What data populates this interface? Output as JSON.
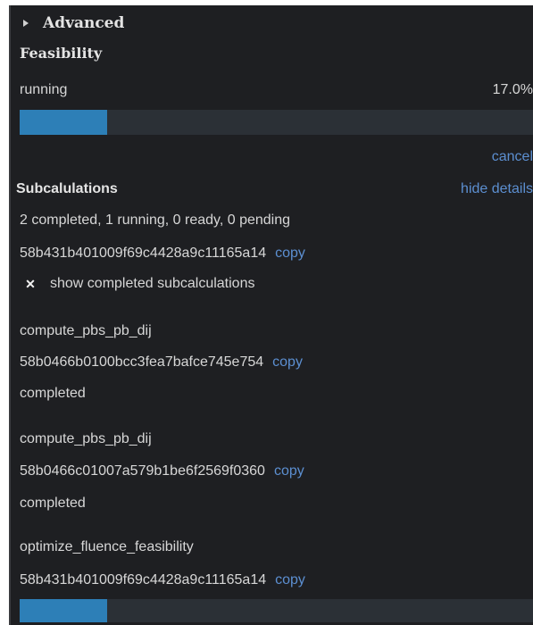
{
  "advanced": {
    "label": "Advanced"
  },
  "feasibility": {
    "title": "Feasibility",
    "status": "running",
    "percent_text": "17.0%",
    "progress": 0.17,
    "cancel_label": "cancel"
  },
  "subcalculations": {
    "title": "Subcalulations",
    "hide_details_label": "hide details",
    "summary": "2 completed, 1 running, 0 ready, 0 pending",
    "id": "58b431b401009f69c4428a9c11165a14",
    "copy_label": "copy",
    "show_completed_label": "show completed subcalculations",
    "show_completed_checked": true,
    "items": [
      {
        "name": "compute_pbs_pb_dij",
        "id": "58b0466b0100bcc3fea7bafce745e754",
        "status": "completed"
      },
      {
        "name": "compute_pbs_pb_dij",
        "id": "58b0466c01007a579b1be6f2569f0360",
        "status": "completed"
      },
      {
        "name": "optimize_fluence_feasibility",
        "id": "58b431b401009f69c4428a9c11165a14",
        "progress": 0.17
      }
    ]
  },
  "colors": {
    "panel_bg": "#1e1f22",
    "bar_track": "#2b3036",
    "bar_fill": "#2d7fb7",
    "link": "#5c8fd1"
  },
  "icons": {
    "advanced": "triangle-right-icon",
    "checkbox": "x-mark-icon"
  }
}
